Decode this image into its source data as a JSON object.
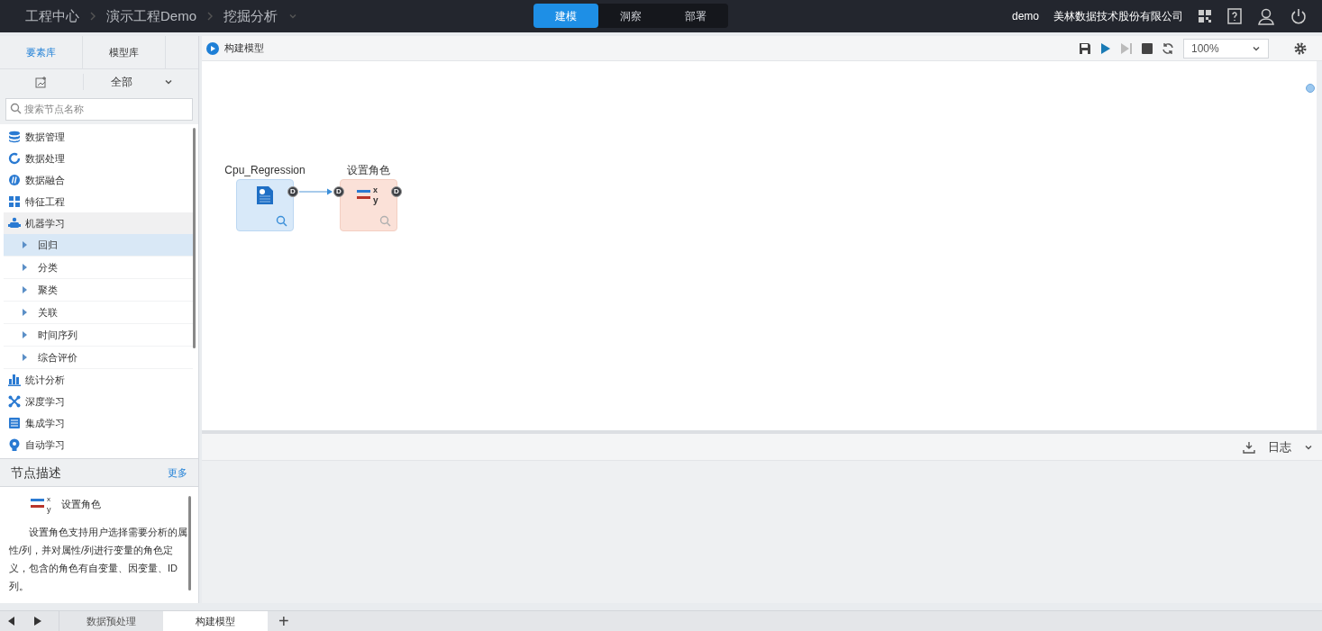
{
  "breadcrumb": [
    "工程中心",
    "演示工程Demo",
    "挖掘分析"
  ],
  "mode_tabs": [
    {
      "label": "建模",
      "selected": true
    },
    {
      "label": "洞察",
      "selected": false
    },
    {
      "label": "部署",
      "selected": false
    }
  ],
  "user": "demo",
  "company": "美林数据技术股份有限公司",
  "library_tabs": [
    {
      "label": "要素库",
      "selected": true
    },
    {
      "label": "模型库",
      "selected": false
    }
  ],
  "filter": "全部",
  "search": {
    "placeholder": "搜索节点名称"
  },
  "tree": [
    {
      "label": "数据管理",
      "expanded": false
    },
    {
      "label": "数据处理",
      "expanded": false
    },
    {
      "label": "数据融合",
      "expanded": false
    },
    {
      "label": "特征工程",
      "expanded": false
    },
    {
      "label": "机器学习",
      "expanded": true,
      "children": [
        {
          "label": "回归",
          "expanded": false,
          "selected": true
        },
        {
          "label": "分类",
          "expanded": false,
          "selected": false
        },
        {
          "label": "聚类",
          "expanded": false,
          "selected": false
        },
        {
          "label": "关联",
          "expanded": false,
          "selected": false
        },
        {
          "label": "时间序列",
          "expanded": false,
          "selected": false
        },
        {
          "label": "综合评价",
          "expanded": false,
          "selected": false
        }
      ]
    },
    {
      "label": "统计分析",
      "expanded": false
    },
    {
      "label": "深度学习",
      "expanded": false
    },
    {
      "label": "集成学习",
      "expanded": false
    },
    {
      "label": "自动学习",
      "expanded": false
    }
  ],
  "description": {
    "title": "节点描述",
    "more": "更多",
    "node_name": "设置角色",
    "icon_letters": [
      "x",
      "y"
    ],
    "text": "设置角色支持用户选择需要分析的属性/列，并对属性/列进行变量的角色定义，包含的角色有自变量、因变量、ID列。"
  },
  "canvas": {
    "title": "构建模型",
    "zoom": "100%",
    "nodes": [
      {
        "label": "Cpu_Regression",
        "kind": "dataset",
        "out_ports": [
          "D"
        ]
      },
      {
        "label": "设置角色",
        "kind": "role",
        "icon_letters": [
          "x",
          "y"
        ],
        "in_ports": [
          "D"
        ],
        "out_ports": [
          "D"
        ]
      }
    ]
  },
  "log": {
    "title": "日志"
  },
  "bottom_tabs": [
    {
      "label": "数据预处理",
      "selected": false
    },
    {
      "label": "构建模型",
      "selected": true
    }
  ],
  "add_tab": "+"
}
